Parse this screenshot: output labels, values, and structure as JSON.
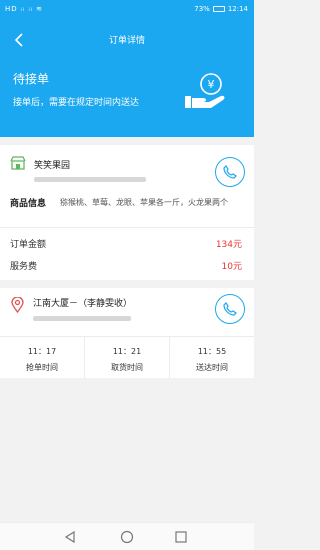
{
  "status_bar": {
    "left": "HD ᵢₗ ᵢₗ ≋",
    "battery": "73%",
    "time": "12:14"
  },
  "header": {
    "title": "订单详情",
    "order_status": "待接单",
    "order_status_desc": "接单后，需要在规定时间内送达"
  },
  "shop": {
    "name": "笑笑果园",
    "goods_label": "商品信息",
    "goods_text": "猕猴桃、草莓、龙眼、苹果各一斤，火龙果两个"
  },
  "fees": {
    "order_amount_label": "订单金额",
    "order_amount_value": "134元",
    "service_fee_label": "服务费",
    "service_fee_value": "10元"
  },
  "delivery": {
    "name": "江南大厦－（李静雯收）"
  },
  "times": [
    {
      "time": "11：17",
      "label": "抢单时间"
    },
    {
      "time": "11：21",
      "label": "取货时间"
    },
    {
      "time": "11：55",
      "label": "送达时间"
    }
  ],
  "icons": {
    "back": "back-icon",
    "hand_coin": "hand-coin-icon",
    "shop": "shop-icon",
    "phone": "phone-icon",
    "location": "location-pin-icon"
  },
  "colors": {
    "primary": "#1ca8f0",
    "price": "#e33333",
    "shop_icon": "#5fb85f",
    "location_icon": "#e55050"
  }
}
